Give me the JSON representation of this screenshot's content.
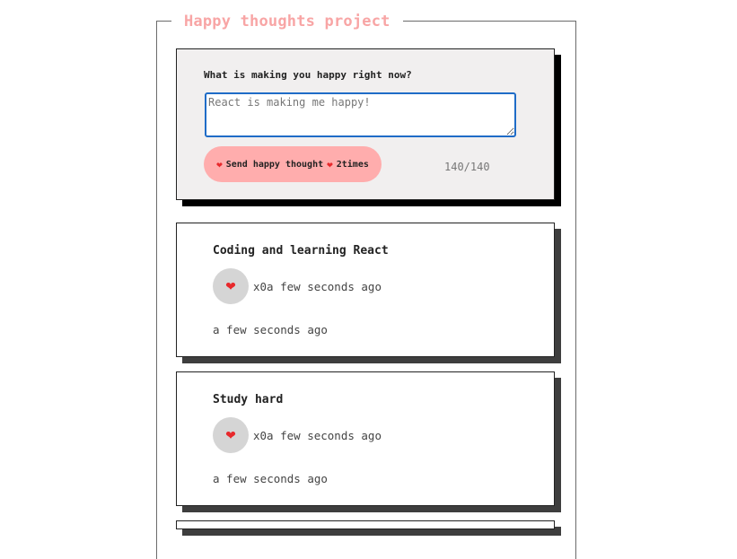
{
  "project": {
    "title": "Happy thoughts project"
  },
  "form": {
    "question": "What is making you happy right now?",
    "input_placeholder": "React is making me happy!",
    "input_value": "",
    "send_label": "Send happy thought",
    "send_suffix": "2times",
    "char_count": "140/140"
  },
  "thoughts": [
    {
      "text": "Coding and learning React",
      "like_info": "x0a few seconds ago",
      "time": "a few seconds ago"
    },
    {
      "text": "Study hard",
      "like_info": "x0a few seconds ago",
      "time": "a few seconds ago"
    },
    {
      "text": "",
      "like_info": "",
      "time": ""
    }
  ],
  "icons": {
    "heart": "heart-icon"
  },
  "colors": {
    "accent": "#ffadad",
    "title": "#f8a5a5",
    "heart": "#e8282b",
    "like_bg": "#d5d5d5",
    "form_bg": "#f1efef",
    "input_focus": "#1f6cc7"
  }
}
